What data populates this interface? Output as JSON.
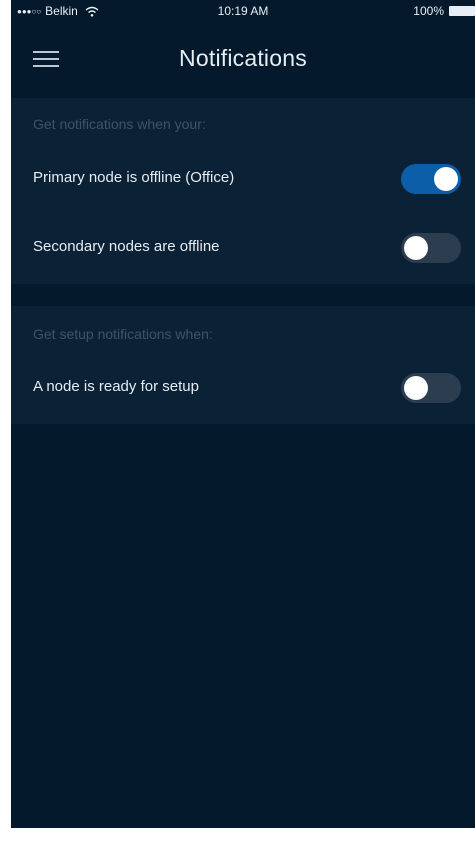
{
  "status_bar": {
    "signal": "●●●○○",
    "carrier": "Belkin",
    "time": "10:19 AM",
    "battery": "100%"
  },
  "header": {
    "title": "Notifications",
    "menu_icon": "hamburger-menu-icon"
  },
  "sections": [
    {
      "heading": "Get notifications when your:",
      "rows": [
        {
          "label": "Primary node is offline (Office)",
          "toggle_on": true
        },
        {
          "label": "Secondary nodes are offline",
          "toggle_on": false
        }
      ]
    },
    {
      "heading": "Get setup notifications when:",
      "rows": [
        {
          "label": "A node is ready for setup",
          "toggle_on": false
        }
      ]
    }
  ],
  "colors": {
    "background": "#04192c",
    "section_background": "#0b2135",
    "toggle_on": "#0d5ea8",
    "toggle_off": "#2b3d4e",
    "heading_text": "#3c5469"
  }
}
